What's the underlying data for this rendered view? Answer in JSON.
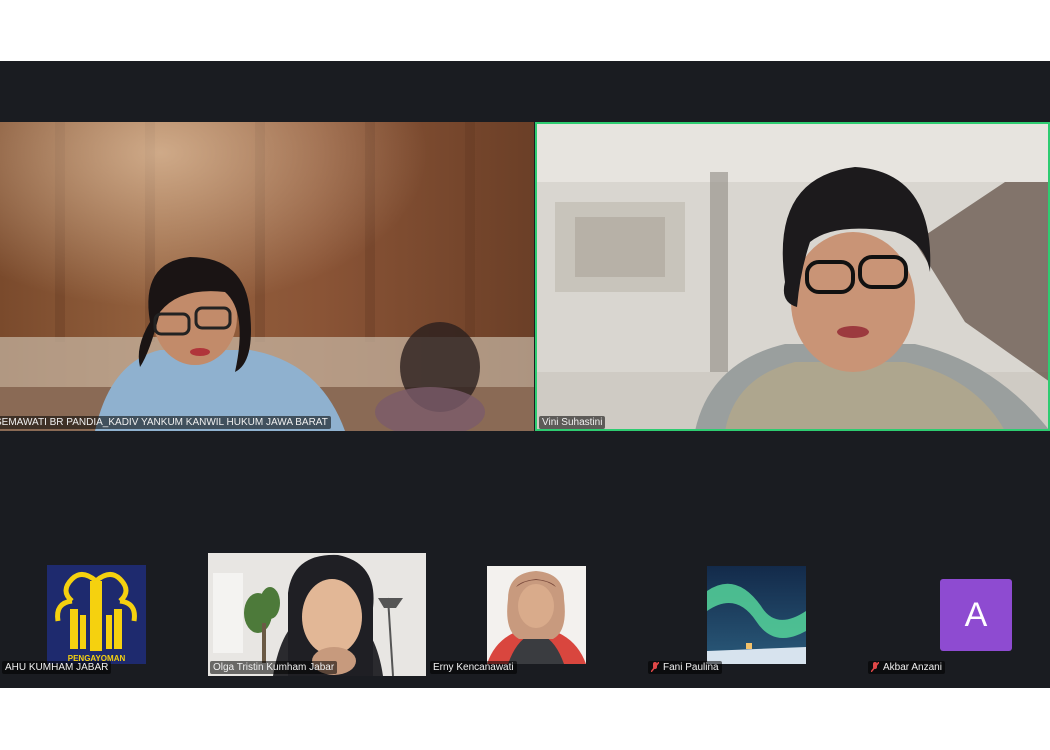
{
  "app": {
    "accent": "#2ecc71",
    "background": "#1a1c21"
  },
  "participants_main": [
    {
      "name": "SEMAWATI BR PANDIA_KADIV YANKUM KANWIL HUKUM JAWA BARAT",
      "speaking": false
    },
    {
      "name": "Vini Suhastini",
      "speaking": true
    }
  ],
  "participants_strip": [
    {
      "name": "AHU KUMHAM JABAR",
      "muted": false,
      "avatar": "pengayoman-logo",
      "logo_text": "PENGAYOMAN"
    },
    {
      "name": "Olga Tristin Kumham Jabar",
      "muted": false,
      "avatar": "video"
    },
    {
      "name": "Erny Kencanawati",
      "muted": false,
      "avatar": "photo"
    },
    {
      "name": "Fani Paulina",
      "muted": true,
      "avatar": "aurora-photo"
    },
    {
      "name": "Akbar Anzani",
      "muted": true,
      "avatar": "letter",
      "letter": "A",
      "color": "#8e4bd1"
    }
  ]
}
